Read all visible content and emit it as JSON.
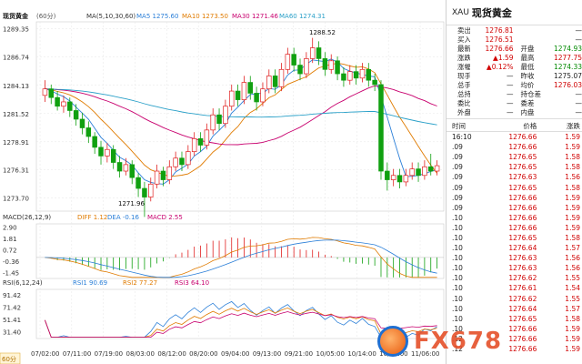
{
  "chart": {
    "title": "现货黄金",
    "period": "(60分)",
    "ma_label": "MA(5,10,30,60)",
    "ma5": "MA5 1275.60",
    "ma10": "MA10 1273.50",
    "ma30": "MA30 1271.46",
    "ma60": "MA60 1274.31",
    "macd_label": "MACD(26,12,9)",
    "diff": "DIFF 1.12",
    "dea": "DEA -0.16",
    "macd": "MACD 2.55",
    "rsi_label": "RSI(6,12,24)",
    "rsi1": "RSI1 90.69",
    "rsi2": "RSI2 77.27",
    "rsi3": "RSI3 64.10",
    "high_mark": "1288.52",
    "low_mark": "1271.96",
    "period_badge": "60分",
    "price_ticks": [
      "1289.35",
      "1286.74",
      "1284.13",
      "1281.52",
      "1278.91",
      "1276.31",
      "1273.70"
    ],
    "macd_ticks": [
      "2.90",
      "1.81",
      "0.72",
      "-0.36",
      "-1.45"
    ],
    "rsi_ticks": [
      "91.42",
      "71.42",
      "51.41",
      "31.40"
    ],
    "dates": [
      "07/02:00",
      "07/11:00",
      "07/19:00",
      "08/03:00",
      "08/12:00",
      "08/20:00",
      "09/04:00",
      "09/13:00",
      "09/21:00",
      "10/05:00",
      "10/14:00",
      "10/22:00",
      "11/06:00"
    ],
    "watermark": "FX678"
  },
  "colors": {
    "up": "#e02020",
    "down": "#10a010",
    "ma5": "#2b7fd8",
    "ma10": "#e07b00",
    "ma30": "#c8006e",
    "ma60": "#2aa0c8",
    "grid": "#e6e6e6"
  },
  "chart_data": {
    "type": "candlestick",
    "instrument": "XAU 现货黄金",
    "timeframe": "60分",
    "ylim": [
      1272.5,
      1290.0
    ],
    "high": 1288.52,
    "low": 1271.96,
    "candles": [
      [
        1283.2,
        1283.8,
        1284.6,
        1282.6
      ],
      [
        1283.8,
        1283.0,
        1284.2,
        1282.4
      ],
      [
        1283.0,
        1282.2,
        1283.6,
        1281.8
      ],
      [
        1282.2,
        1282.6,
        1283.2,
        1281.6
      ],
      [
        1282.6,
        1281.8,
        1283.0,
        1281.2
      ],
      [
        1281.8,
        1281.0,
        1282.4,
        1280.4
      ],
      [
        1281.0,
        1280.2,
        1281.6,
        1279.6
      ],
      [
        1280.2,
        1279.4,
        1280.8,
        1278.8
      ],
      [
        1279.4,
        1278.4,
        1279.8,
        1277.8
      ],
      [
        1278.4,
        1277.6,
        1279.0,
        1276.8
      ],
      [
        1277.6,
        1278.2,
        1278.8,
        1277.0
      ],
      [
        1278.2,
        1277.0,
        1278.6,
        1276.4
      ],
      [
        1277.0,
        1276.2,
        1277.6,
        1275.6
      ],
      [
        1276.2,
        1276.8,
        1277.4,
        1275.8
      ],
      [
        1276.8,
        1275.6,
        1277.2,
        1275.0
      ],
      [
        1275.6,
        1274.6,
        1276.0,
        1273.8
      ],
      [
        1274.6,
        1273.8,
        1275.2,
        1271.96
      ],
      [
        1273.8,
        1275.0,
        1275.6,
        1273.4
      ],
      [
        1275.0,
        1276.2,
        1276.8,
        1274.6
      ],
      [
        1276.2,
        1275.4,
        1276.6,
        1274.8
      ],
      [
        1275.4,
        1276.6,
        1277.2,
        1275.0
      ],
      [
        1276.6,
        1277.4,
        1278.0,
        1276.2
      ],
      [
        1277.4,
        1276.8,
        1278.0,
        1276.2
      ],
      [
        1276.8,
        1278.0,
        1278.6,
        1276.4
      ],
      [
        1278.0,
        1279.2,
        1279.8,
        1277.6
      ],
      [
        1279.2,
        1278.6,
        1279.8,
        1278.0
      ],
      [
        1278.6,
        1280.0,
        1280.6,
        1278.2
      ],
      [
        1280.0,
        1281.4,
        1282.0,
        1279.6
      ],
      [
        1281.4,
        1280.6,
        1282.0,
        1280.0
      ],
      [
        1280.6,
        1282.2,
        1282.8,
        1280.2
      ],
      [
        1282.2,
        1283.6,
        1284.2,
        1281.8
      ],
      [
        1283.6,
        1282.8,
        1284.2,
        1282.2
      ],
      [
        1282.8,
        1284.4,
        1285.0,
        1282.4
      ],
      [
        1284.4,
        1283.4,
        1285.0,
        1282.8
      ],
      [
        1283.4,
        1282.6,
        1284.0,
        1281.8
      ],
      [
        1282.6,
        1283.8,
        1284.4,
        1282.2
      ],
      [
        1283.8,
        1285.0,
        1285.6,
        1283.4
      ],
      [
        1285.0,
        1284.0,
        1285.6,
        1283.4
      ],
      [
        1284.0,
        1285.6,
        1286.2,
        1283.6
      ],
      [
        1285.6,
        1287.0,
        1287.6,
        1285.2
      ],
      [
        1287.0,
        1286.0,
        1287.6,
        1285.4
      ],
      [
        1286.0,
        1285.2,
        1286.6,
        1284.6
      ],
      [
        1285.2,
        1286.6,
        1287.2,
        1284.8
      ],
      [
        1286.6,
        1287.6,
        1288.52,
        1286.2
      ],
      [
        1287.6,
        1286.6,
        1288.2,
        1286.0
      ],
      [
        1286.6,
        1285.6,
        1287.2,
        1285.0
      ],
      [
        1285.6,
        1286.4,
        1287.0,
        1285.2
      ],
      [
        1286.4,
        1285.2,
        1286.8,
        1284.6
      ],
      [
        1285.2,
        1284.6,
        1285.8,
        1284.0
      ],
      [
        1284.6,
        1285.4,
        1286.0,
        1284.2
      ],
      [
        1285.4,
        1284.8,
        1286.0,
        1284.2
      ],
      [
        1284.8,
        1285.6,
        1286.2,
        1284.4
      ],
      [
        1285.6,
        1284.6,
        1286.2,
        1284.0
      ],
      [
        1284.6,
        1284.2,
        1285.2,
        1283.6
      ],
      [
        1284.2,
        1276.2,
        1284.6,
        1275.4
      ],
      [
        1276.2,
        1275.4,
        1277.0,
        1274.4
      ],
      [
        1275.4,
        1275.8,
        1276.4,
        1274.8
      ],
      [
        1275.8,
        1275.2,
        1276.4,
        1274.6
      ],
      [
        1275.2,
        1275.8,
        1276.4,
        1274.8
      ],
      [
        1275.8,
        1276.4,
        1277.0,
        1275.4
      ],
      [
        1276.4,
        1275.8,
        1277.0,
        1275.2
      ],
      [
        1275.8,
        1276.6,
        1277.2,
        1275.4
      ],
      [
        1276.6,
        1276.2,
        1277.8,
        1275.8
      ],
      [
        1276.2,
        1276.7,
        1277.2,
        1275.8
      ]
    ]
  },
  "quote": {
    "code": "XAU",
    "name": "现货黄金",
    "rows": [
      {
        "l1": "卖出",
        "v1": "1276.81",
        "c1": "red",
        "l2": "",
        "v2": "—",
        "c2": "dark"
      },
      {
        "l1": "买入",
        "v1": "1276.51",
        "c1": "red",
        "l2": "",
        "v2": "—",
        "c2": "dark"
      },
      {
        "l1": "最新",
        "v1": "1276.66",
        "c1": "red",
        "l2": "开盘",
        "v2": "1274.93",
        "c2": "green"
      },
      {
        "l1": "涨跌",
        "v1": "▲1.59",
        "c1": "red",
        "l2": "最高",
        "v2": "1277.75",
        "c2": "red"
      },
      {
        "l1": "涨幅",
        "v1": "▲0.12%",
        "c1": "red",
        "l2": "最低",
        "v2": "1274.33",
        "c2": "green"
      },
      {
        "l1": "现手",
        "v1": "—",
        "c1": "dark",
        "l2": "昨收",
        "v2": "1275.07",
        "c2": "dark"
      },
      {
        "l1": "总手",
        "v1": "—",
        "c1": "dark",
        "l2": "均价",
        "v2": "1276.03",
        "c2": "red"
      },
      {
        "l1": "总持",
        "v1": "—",
        "c1": "dark",
        "l2": "持仓差",
        "v2": "—",
        "c2": "dark"
      },
      {
        "l1": "委比",
        "v1": "—",
        "c1": "dark",
        "l2": "委差",
        "v2": "—",
        "c2": "dark"
      },
      {
        "l1": "外盘",
        "v1": "—",
        "c1": "dark",
        "l2": "内盘",
        "v2": "—",
        "c2": "dark"
      }
    ],
    "ticks_header": {
      "time": "时间",
      "price": "价格",
      "change": "涨跌"
    },
    "ticks": [
      {
        "t": "16:10",
        "p": "1276.66",
        "c": "1.59"
      },
      {
        "t": ".09",
        "p": "1276.66",
        "c": "1.59"
      },
      {
        "t": ".09",
        "p": "1276.65",
        "c": "1.58"
      },
      {
        "t": ".09",
        "p": "1276.65",
        "c": "1.58"
      },
      {
        "t": ".09",
        "p": "1276.63",
        "c": "1.56"
      },
      {
        "t": ".09",
        "p": "1276.65",
        "c": "1.58"
      },
      {
        "t": ".09",
        "p": "1276.66",
        "c": "1.59"
      },
      {
        "t": ".09",
        "p": "1276.66",
        "c": "1.59"
      },
      {
        "t": ".10",
        "p": "1276.66",
        "c": "1.59"
      },
      {
        "t": ".10",
        "p": "1276.66",
        "c": "1.59"
      },
      {
        "t": ".10",
        "p": "1276.65",
        "c": "1.58"
      },
      {
        "t": ".10",
        "p": "1276.64",
        "c": "1.57"
      },
      {
        "t": ".10",
        "p": "1276.63",
        "c": "1.56"
      },
      {
        "t": ".10",
        "p": "1276.63",
        "c": "1.56"
      },
      {
        "t": ".10",
        "p": "1276.62",
        "c": "1.55"
      },
      {
        "t": ".10",
        "p": "1276.61",
        "c": "1.54"
      },
      {
        "t": ".10",
        "p": "1276.62",
        "c": "1.55"
      },
      {
        "t": ".10",
        "p": "1276.64",
        "c": "1.57"
      },
      {
        "t": ".10",
        "p": "1276.65",
        "c": "1.58"
      },
      {
        "t": ".10",
        "p": "1276.66",
        "c": "1.59"
      },
      {
        "t": ".12",
        "p": "1276.66",
        "c": "1.59"
      },
      {
        "t": ".12",
        "p": "1276.66",
        "c": "1.59"
      }
    ]
  }
}
